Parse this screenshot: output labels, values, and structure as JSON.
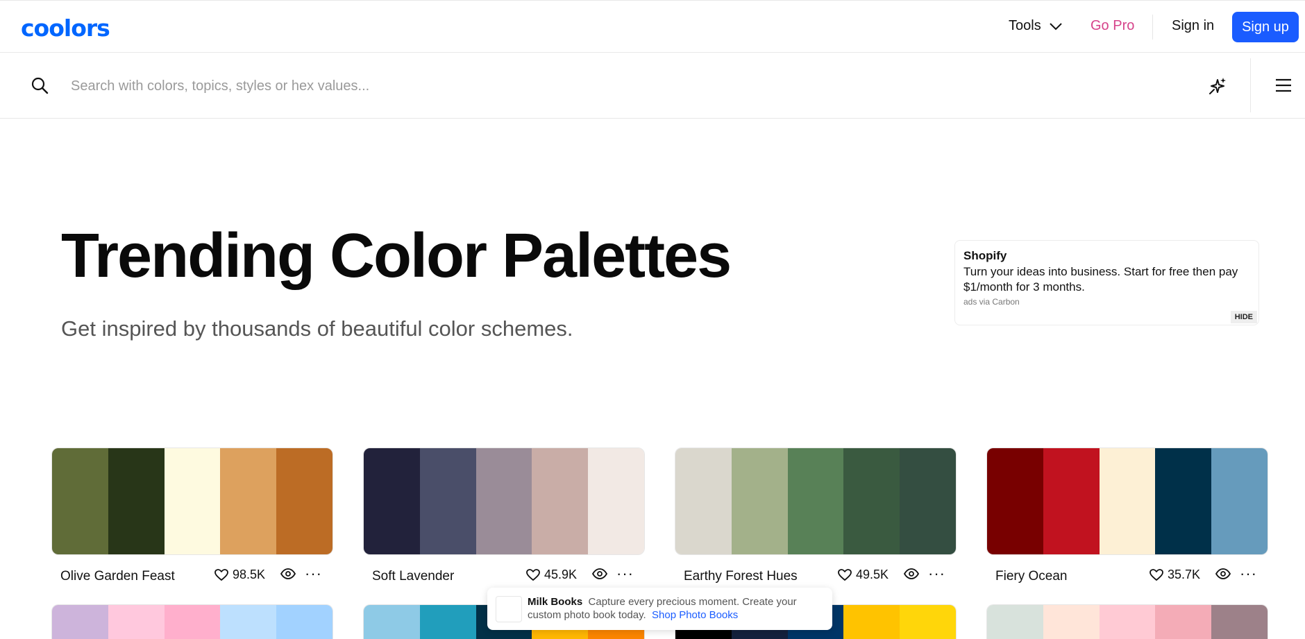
{
  "header": {
    "logo": "coolors",
    "tools_label": "Tools",
    "gopro_label": "Go Pro",
    "signin_label": "Sign in",
    "signup_label": "Sign up"
  },
  "search": {
    "placeholder": "Search with colors, topics, styles or hex values..."
  },
  "hero": {
    "title": "Trending Color Palettes",
    "subtitle": "Get inspired by thousands of beautiful color schemes."
  },
  "ad": {
    "brand": "Shopify",
    "text": "Turn your ideas into business. Start for free then pay $1/month for 3 months.",
    "via": "ads via Carbon",
    "hide_label": "HIDE"
  },
  "palettes": [
    {
      "name": "Olive Garden Feast",
      "likes": "98.5K",
      "colors": [
        "#606c38",
        "#283618",
        "#fefae0",
        "#dda15e",
        "#bc6c25"
      ]
    },
    {
      "name": "Soft Lavender",
      "likes": "45.9K",
      "colors": [
        "#22223b",
        "#4a4e69",
        "#9a8c98",
        "#c9ada7",
        "#f2e9e4"
      ]
    },
    {
      "name": "Earthy Forest Hues",
      "likes": "49.5K",
      "colors": [
        "#dad7cd",
        "#a3b18a",
        "#588157",
        "#3a5a40",
        "#344e41"
      ]
    },
    {
      "name": "Fiery Ocean",
      "likes": "35.7K",
      "colors": [
        "#780000",
        "#c1121f",
        "#fdf0d5",
        "#003049",
        "#669bbc"
      ]
    }
  ],
  "palettes_row2": [
    {
      "colors": [
        "#cdb4db",
        "#ffc8dd",
        "#ffafcc",
        "#bde0fe",
        "#a2d2ff"
      ]
    },
    {
      "colors": [
        "#8ecae6",
        "#219ebc",
        "#023047",
        "#ffb703",
        "#fb8500"
      ]
    },
    {
      "colors": [
        "#000000",
        "#14213d",
        "#003566",
        "#ffc300",
        "#ffd60a"
      ]
    },
    {
      "colors": [
        "#d8e2dc",
        "#ffe5d9",
        "#ffcad4",
        "#f4acb7",
        "#9d8189"
      ]
    }
  ],
  "popup": {
    "brand": "Milk Books",
    "text": "Capture every precious moment. Create your custom photo book today.",
    "link": "Shop Photo Books"
  },
  "colors": {
    "brand_blue": "#0066ff",
    "signup_bg": "#1a5cff",
    "gopro": "#d6438a"
  }
}
